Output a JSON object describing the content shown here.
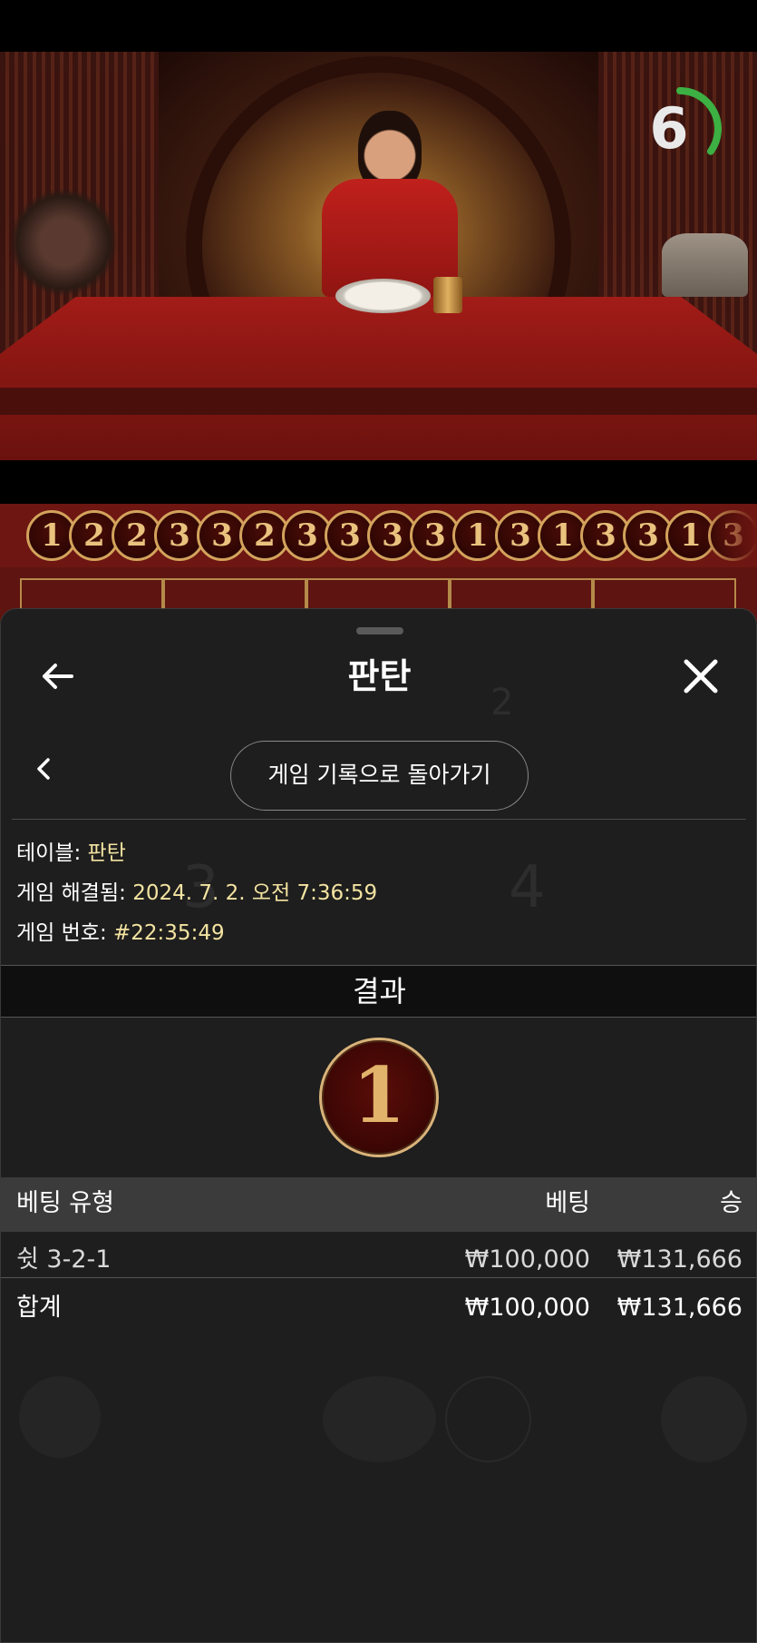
{
  "timer": {
    "seconds": "6",
    "remaining_fraction": 0.35
  },
  "road": {
    "results": [
      "1",
      "2",
      "2",
      "3",
      "3",
      "2",
      "3",
      "3",
      "3",
      "3",
      "1",
      "3",
      "1",
      "3",
      "3",
      "1",
      "3"
    ]
  },
  "sheet": {
    "title": "판탄",
    "back_to_history": "게임 기록으로 돌아가기",
    "info": {
      "table_label": "테이블:",
      "table_value": "판탄",
      "resolved_label": "게임 해결됨:",
      "resolved_value": "2024. 7. 2. 오전 7:36:59",
      "game_no_label": "게임 번호:",
      "game_no_value": "#22:35:49"
    },
    "result_header": "결과",
    "result_value": "1",
    "bets": {
      "headers": {
        "type": "베팅 유형",
        "bet": "베팅",
        "win": "승"
      },
      "rows": [
        {
          "type": "쉿 3-2-1",
          "bet": "₩100,000",
          "win": "₩131,666"
        }
      ],
      "total": {
        "label": "합계",
        "bet": "₩100,000",
        "win": "₩131,666"
      }
    }
  },
  "colors": {
    "accent_gold": "#d9b37a",
    "value_yellow": "#f3e3a1",
    "timer_green": "#3cb043",
    "sheet_bg": "#1e1e1e"
  }
}
